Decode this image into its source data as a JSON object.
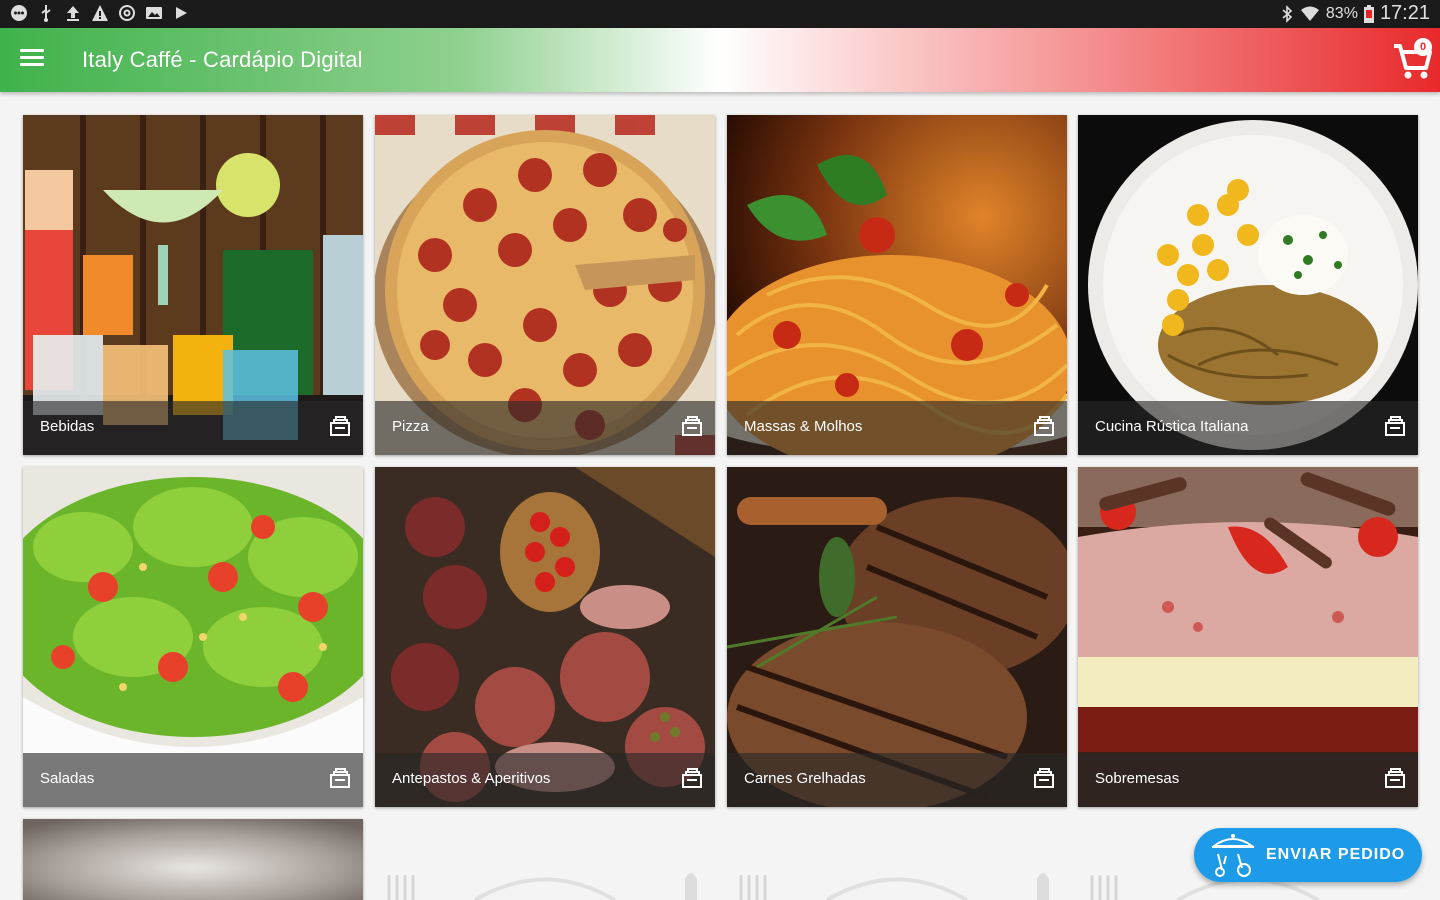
{
  "status_bar": {
    "battery": "83%",
    "time": "17:21"
  },
  "app_bar": {
    "title": "Italy Caffé - Cardápio Digital",
    "cart_count": "0"
  },
  "categories": [
    {
      "label": "Bebidas"
    },
    {
      "label": "Pizza"
    },
    {
      "label": "Massas & Molhos"
    },
    {
      "label": "Cucina Rústica Italiana"
    },
    {
      "label": "Saladas"
    },
    {
      "label": "Antepastos & Aperitivos"
    },
    {
      "label": "Carnes Grelhadas"
    },
    {
      "label": "Sobremesas"
    }
  ],
  "fab": {
    "label": "ENVIAR PEDIDO"
  },
  "colors": {
    "brand_green": "#3fb24b",
    "brand_red": "#e8292b",
    "fab_blue": "#1e9be8"
  }
}
